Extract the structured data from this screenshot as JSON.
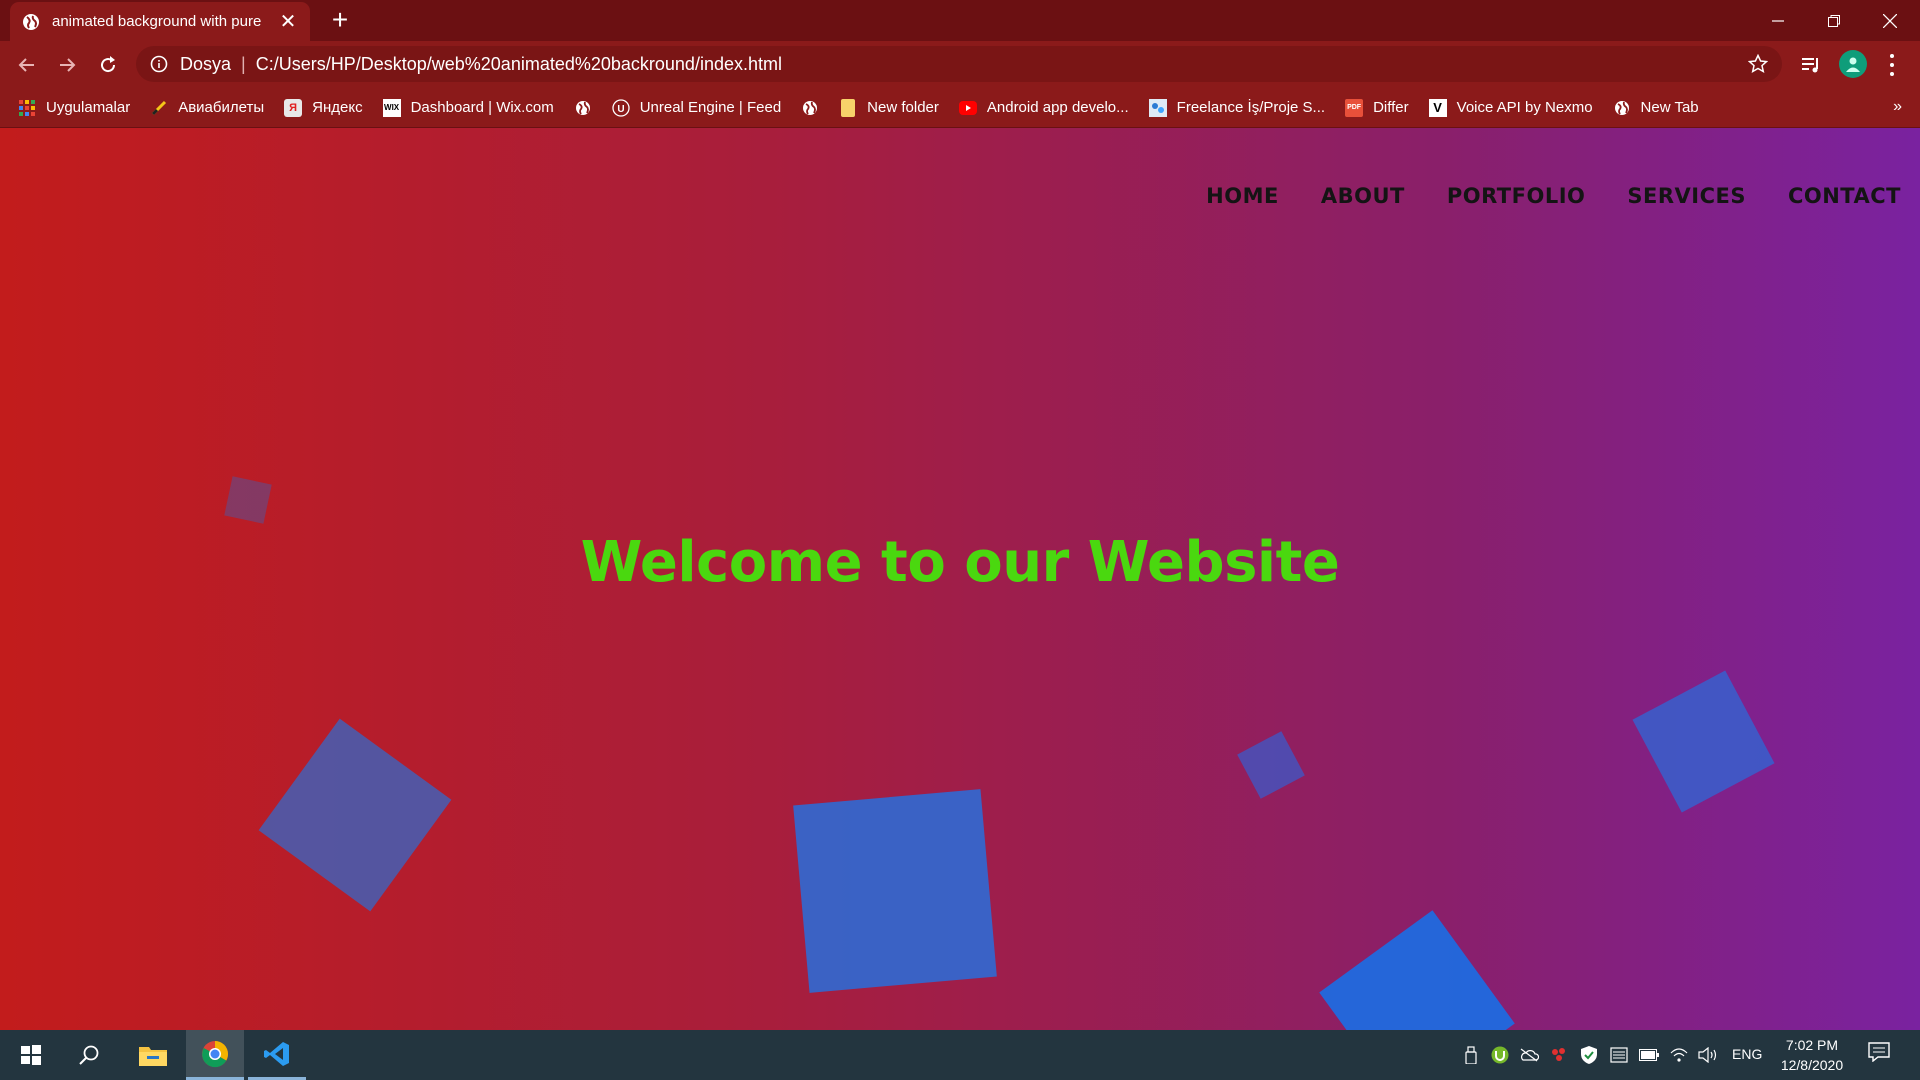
{
  "browser": {
    "tab": {
      "title": "animated background with pure",
      "close": "✕"
    },
    "new_tab": "+",
    "window_controls": [
      "minimize",
      "restore",
      "close"
    ],
    "toolbar": {
      "scheme_label": "Dosya",
      "separator": "|",
      "url": "C:/Users/HP/Desktop/web%20animated%20backround/index.html"
    },
    "bookmarks": [
      {
        "label": "Uygulamalar",
        "icon": "apps-grid-icon"
      },
      {
        "label": "Авиабилеты",
        "icon": "aviasales-icon"
      },
      {
        "label": "Яндекс",
        "icon": "yandex-icon"
      },
      {
        "label": "Dashboard | Wix.com",
        "icon": "wix-icon"
      },
      {
        "label": "",
        "icon": "globe-icon"
      },
      {
        "label": "Unreal Engine | Feed",
        "icon": "unreal-icon"
      },
      {
        "label": "",
        "icon": "globe-icon"
      },
      {
        "label": "New folder",
        "icon": "folder-icon"
      },
      {
        "label": "Android app develo...",
        "icon": "youtube-icon"
      },
      {
        "label": "Freelance İş/Proje S...",
        "icon": "freelance-icon"
      },
      {
        "label": "Differ",
        "icon": "pdf-icon"
      },
      {
        "label": "Voice API by Nexmo",
        "icon": "vonage-icon"
      },
      {
        "label": "New Tab",
        "icon": "globe-icon"
      }
    ],
    "bookmarks_overflow": "»"
  },
  "page": {
    "nav": [
      "HOME",
      "ABOUT",
      "PORTFOLIO",
      "SERVICES",
      "CONTACT"
    ],
    "hero_title": "Welcome to our Website",
    "colors": {
      "gradient_start": "#c21c1c",
      "gradient_end": "#7a22a0",
      "title": "#4ad80f",
      "cube": "#2a6fdc"
    }
  },
  "taskbar": {
    "items": [
      "windows-start-icon",
      "search-icon",
      "file-explorer-icon",
      "chrome-icon",
      "vscode-icon"
    ],
    "tray": [
      "usb-icon",
      "utorrent-icon",
      "onedrive-icon",
      "app-tray-icon",
      "security-icon",
      "storage-icon",
      "battery-icon",
      "wifi-icon",
      "volume-icon"
    ],
    "language": "ENG",
    "time": "7:02 PM",
    "date": "12/8/2020"
  }
}
